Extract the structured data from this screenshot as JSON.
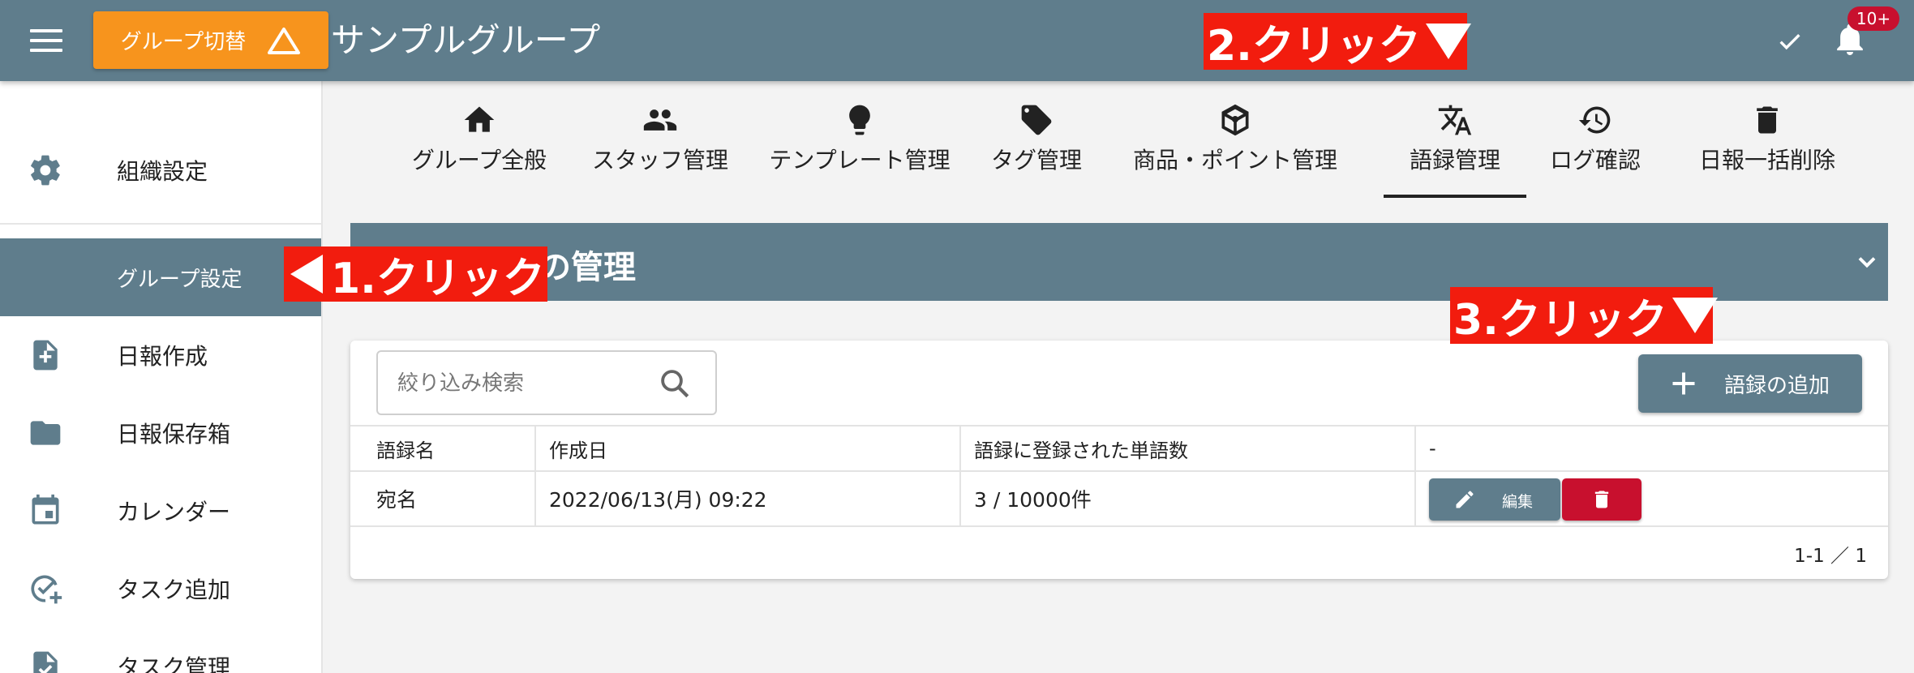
{
  "topbar": {
    "group_switch_label": "グループ切替",
    "group_name": "サンプルグループ",
    "notification_badge": "10+"
  },
  "sidebar": {
    "items": [
      {
        "label": "組織設定",
        "icon": "gear-icon"
      },
      {
        "label": "グループ設定",
        "icon": "",
        "active": true
      },
      {
        "label": "日報作成",
        "icon": "file-add-icon"
      },
      {
        "label": "日報保存箱",
        "icon": "folder-icon"
      },
      {
        "label": "カレンダー",
        "icon": "calendar-icon"
      },
      {
        "label": "タスク追加",
        "icon": "check-add-icon"
      },
      {
        "label": "タスク管理",
        "icon": "task-file-icon"
      }
    ]
  },
  "tabs": [
    {
      "label": "グループ全般",
      "icon": "home-icon"
    },
    {
      "label": "スタッフ管理",
      "icon": "people-icon"
    },
    {
      "label": "テンプレート管理",
      "icon": "lightbulb-icon"
    },
    {
      "label": "タグ管理",
      "icon": "tag-icon"
    },
    {
      "label": "商品・ポイント管理",
      "icon": "box-icon"
    },
    {
      "label": "語録管理",
      "icon": "translate-icon",
      "active": true
    },
    {
      "label": "ログ確認",
      "icon": "history-icon"
    },
    {
      "label": "日報一括削除",
      "icon": "trash-icon"
    }
  ],
  "section": {
    "title": "の管理"
  },
  "toolbar": {
    "search_placeholder": "絞り込み検索",
    "add_label": "語録の追加"
  },
  "table": {
    "headers": [
      "語録名",
      "作成日",
      "語録に登録された単語数",
      "-"
    ],
    "rows": [
      {
        "name": "宛名",
        "created": "2022/06/13(月) 09:22",
        "count": "3 / 10000件",
        "edit_label": "編集"
      }
    ],
    "pagination": "1-1 ／ 1"
  },
  "annotations": {
    "step1": "1.クリック",
    "step2": "2.クリック",
    "step3": "3.クリック"
  },
  "colors": {
    "primary": "#5f7d8c",
    "accent_orange": "#f7941d",
    "danger": "#c8102e",
    "annotation_red": "#f21c0e"
  }
}
